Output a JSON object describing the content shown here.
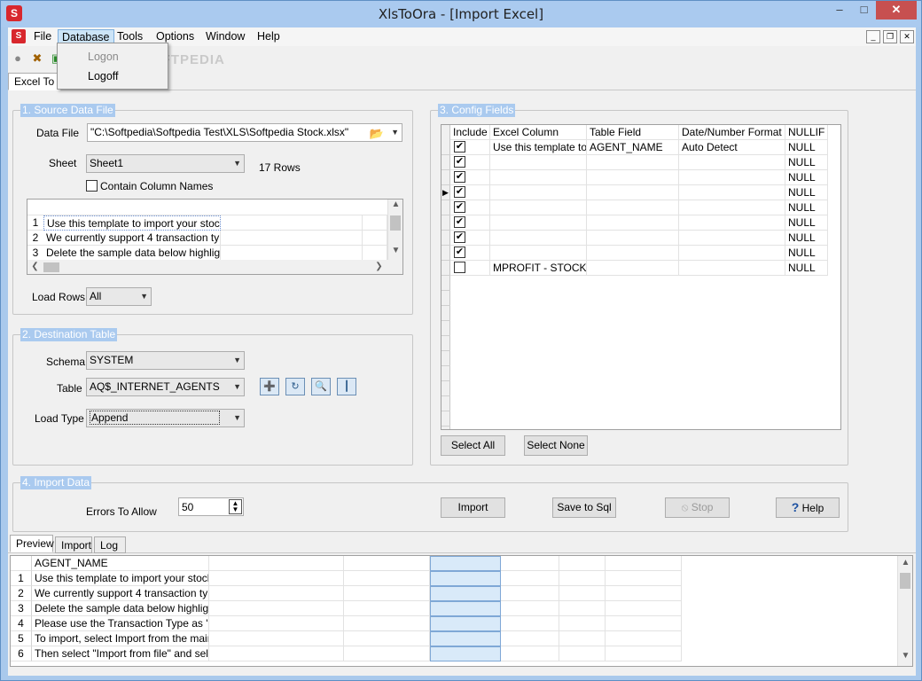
{
  "window": {
    "title": "XlsToOra - [Import Excel]",
    "min": "–",
    "max": "□",
    "close": "✕"
  },
  "menu": {
    "file": "File",
    "database": "Database",
    "tools": "Tools",
    "options": "Options",
    "window": "Window",
    "help": "Help"
  },
  "database_menu": {
    "logon": "Logon",
    "logoff": "Logoff"
  },
  "watermark": "SOFTPEDIA",
  "tabs_top": {
    "excel_to": "Excel To"
  },
  "source": {
    "group_label": "1. Source Data File",
    "data_file_label": "Data File",
    "data_file_value": "\"C:\\Softpedia\\Softpedia Test\\XLS\\Softpedia Stock.xlsx\"",
    "sheet_label": "Sheet",
    "sheet_value": "Sheet1",
    "rows_count": "17 Rows",
    "contain_column_names": "Contain Column Names",
    "preview_rows": [
      {
        "num": "1",
        "text": "Use this template to import your stock tran"
      },
      {
        "num": "2",
        "text": "We currently support 4 transaction types"
      },
      {
        "num": "3",
        "text": "Delete the sample data below highlighted"
      }
    ],
    "load_rows_label": "Load Rows",
    "load_rows_value": "All"
  },
  "destination": {
    "group_label": "2. Destination Table",
    "schema_label": "Schema",
    "schema_value": "SYSTEM",
    "table_label": "Table",
    "table_value": "AQ$_INTERNET_AGENTS",
    "load_type_label": "Load Type",
    "load_type_value": "Append"
  },
  "config": {
    "group_label": "3. Config Fields",
    "columns": [
      "Include",
      "Excel Column",
      "Table Field",
      "Date/Number Format",
      "NULLIF"
    ],
    "rows": [
      {
        "include": true,
        "excel": "Use this template to...",
        "field": "AGENT_NAME",
        "format": "Auto Detect",
        "nullif": "NULL"
      },
      {
        "include": true,
        "excel": "",
        "field": "",
        "format": "",
        "nullif": "NULL"
      },
      {
        "include": true,
        "excel": "",
        "field": "",
        "format": "",
        "nullif": "NULL"
      },
      {
        "include": true,
        "excel": "",
        "field": "",
        "format": "",
        "nullif": "NULL"
      },
      {
        "include": true,
        "excel": "",
        "field": "",
        "format": "",
        "nullif": "NULL"
      },
      {
        "include": true,
        "excel": "",
        "field": "",
        "format": "",
        "nullif": "NULL"
      },
      {
        "include": true,
        "excel": "",
        "field": "",
        "format": "",
        "nullif": "NULL"
      },
      {
        "include": true,
        "excel": "",
        "field": "",
        "format": "",
        "nullif": "NULL"
      },
      {
        "include": false,
        "excel": "MPROFIT - STOCK...",
        "field": "",
        "format": "",
        "nullif": "NULL"
      }
    ],
    "select_all": "Select All",
    "select_none": "Select None"
  },
  "import": {
    "group_label": "4. Import Data",
    "errors_label": "Errors To Allow",
    "errors_value": "50",
    "import_btn": "Import",
    "save_sql_btn": "Save to Sql",
    "stop_btn": "Stop",
    "help_btn": "Help"
  },
  "tabs_bottom": {
    "preview": "Preview",
    "import": "Import",
    "log": "Log"
  },
  "preview": {
    "header": "AGENT_NAME",
    "rows": [
      {
        "num": "1",
        "text": "Use this template to import your stock tran"
      },
      {
        "num": "2",
        "text": "We currently support 4 transaction types"
      },
      {
        "num": "3",
        "text": "Delete the sample data below highlighted"
      },
      {
        "num": "4",
        "text": "Please use the Transaction Type as 'BUY"
      },
      {
        "num": "5",
        "text": "To import, select Import from the main me"
      },
      {
        "num": "6",
        "text": "Then select \"Import from file\" and select t"
      }
    ]
  }
}
